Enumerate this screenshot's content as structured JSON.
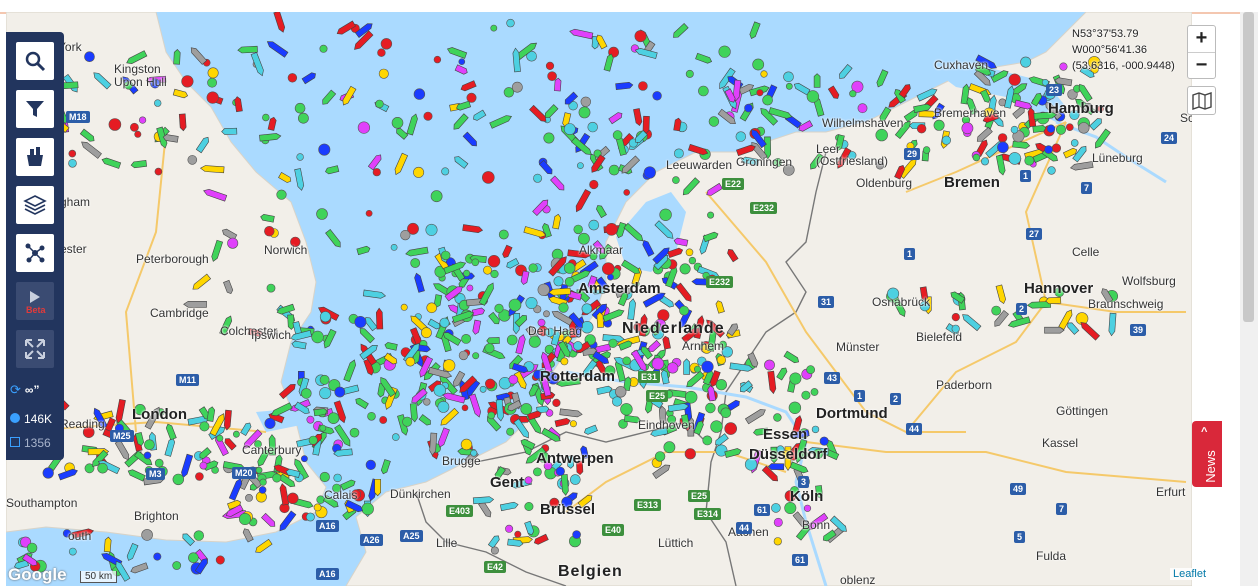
{
  "coords": {
    "lat": "N53°37'53.79",
    "lon": "W000°56'41.36",
    "decimal": "(53.6316, -000.9448)"
  },
  "zoom": {
    "in_label": "+",
    "out_label": "−"
  },
  "sidebar": {
    "stat_refresh": "∞”",
    "stat_info": "146K",
    "stat_box": "1356",
    "play_label": "Beta"
  },
  "news_label": "News",
  "attribution": "Leaflet",
  "google": "Google",
  "scale": "50 km",
  "places": {
    "hamburg": "Hamburg",
    "hannover": "Hannover",
    "bielefeld": "Bielefeld",
    "osnabruck": "Osnabrück",
    "munster": "Münster",
    "dortmund": "Dortmund",
    "essen": "Essen",
    "dusseldorf": "Düsseldorf",
    "koln": "Köln",
    "bonn": "Bonn",
    "kassel": "Kassel",
    "gottingen": "Göttingen",
    "paderborn": "Paderborn",
    "celle": "Celle",
    "wolfsburg": "Wolfsburg",
    "braunschweig": "Braunschweig",
    "bremen": "Bremen",
    "bremerhaven": "Bremerhaven",
    "wilhelmshaven": "Wilhelmshaven",
    "oldenburg": "Oldenburg",
    "leer": "Leer\n(Ostfriesland)",
    "cuxhaven": "Cuxhaven",
    "luneburg": "Lüneburg",
    "groningen": "Groningen",
    "leeuwarden": "Leeuwarden",
    "alkmaar": "Alkmaar",
    "amsterdam": "Amsterdam",
    "denhaag": "Den Haag",
    "rotterdam": "Rotterdam",
    "niederlande": "Niederlande",
    "arnhem": "Arnhem",
    "eindhoven": "Eindhoven",
    "antwerpen": "Antwerpen",
    "gent": "Gent",
    "brugge": "Brugge",
    "brussel": "Brüssel",
    "belgien": "Belgien",
    "aachen": "Aachen",
    "luttich": "Lüttich",
    "lille": "Lille",
    "dunkirchen": "Dünkirchen",
    "calais": "Calais",
    "london": "London",
    "reading": "Reading",
    "canterbury": "Canterbury",
    "colchester": "Colchester",
    "ipswich": "Ipswich",
    "cambridge": "Cambridge",
    "peterborough": "Peterborough",
    "norwich": "Norwich",
    "kingston": "Kingston\nUpon Hull",
    "york": "York",
    "leicester": "ester",
    "nottingham": "gham",
    "southampton": "Southampton",
    "brighton": "Brighton",
    "portsmouth": "outh",
    "fulda": "Fulda",
    "erfurt": "Erfurt",
    "koblenz": "oblenz",
    "sch": "Sc"
  }
}
